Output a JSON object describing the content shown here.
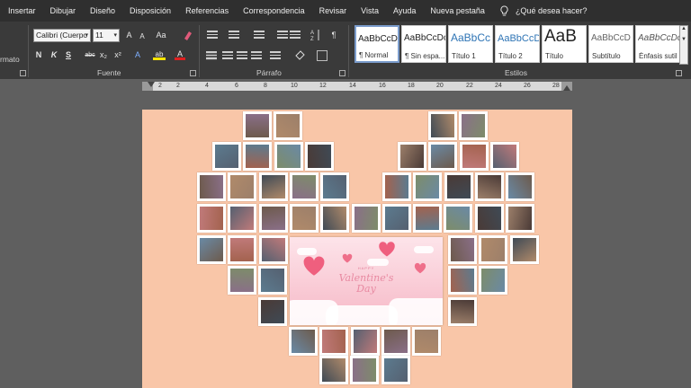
{
  "menu": {
    "tabs": [
      "Insertar",
      "Dibujar",
      "Diseño",
      "Disposición",
      "Referencias",
      "Correspondencia",
      "Revisar",
      "Vista",
      "Ayuda",
      "Nueva pestaña"
    ],
    "tell_me": "¿Qué desea hacer?"
  },
  "ribbon": {
    "clipboard_label": "rmato",
    "font": {
      "label": "Fuente",
      "family": "Calibri (Cuerpo",
      "size": "11",
      "grow": "A",
      "shrink": "A",
      "case": "Aa",
      "bold": "N",
      "italic": "K",
      "underline": "S",
      "strike": "abc",
      "subscript": "x₂",
      "superscript": "x²",
      "effects": "A",
      "highlight": "ab",
      "color": "A"
    },
    "paragraph": {
      "label": "Párrafo",
      "pilcrow": "¶"
    },
    "styles": {
      "label": "Estilos",
      "items": [
        {
          "sample": "AaBbCcDc",
          "name": "¶ Normal"
        },
        {
          "sample": "AaBbCcDc",
          "name": "¶ Sin espa..."
        },
        {
          "sample": "AaBbCc",
          "name": "Título 1"
        },
        {
          "sample": "AaBbCcD",
          "name": "Título 2"
        },
        {
          "sample": "AaB",
          "name": "Título"
        },
        {
          "sample": "AaBbCcD",
          "name": "Subtítulo"
        },
        {
          "sample": "AaBbCcDc",
          "name": "Énfasis sutil"
        }
      ]
    }
  },
  "ruler": {
    "numbers": [
      "2",
      "2",
      "4",
      "6",
      "8",
      "10",
      "12",
      "14",
      "16",
      "18",
      "20",
      "22",
      "24",
      "26",
      "28"
    ]
  },
  "document": {
    "card_small_text": "HAPPY",
    "card_script_line1": "Valentine's",
    "card_script_line2": "Day"
  },
  "colors": {
    "page_bg": "#f9c6a8",
    "ribbon_bg": "#3a3a3a",
    "menu_bg": "#2f2f2f",
    "workspace_bg": "#5f5f5f"
  }
}
